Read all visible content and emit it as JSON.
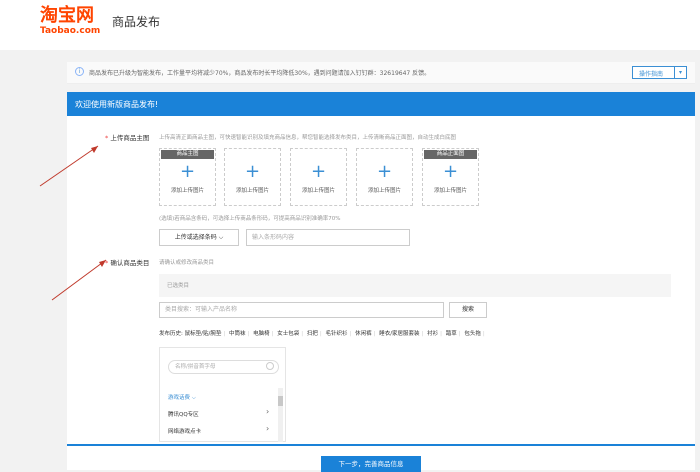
{
  "header": {
    "logo_cn": "淘宝网",
    "logo_en": "Taobao.com",
    "title": "商品发布"
  },
  "notice": {
    "icon": "info-icon",
    "text": "商品发布已升级为智能发布，工作量平均将减少70%，商品发布时长平均降低30%，遇到问题请加入钉钉群：32619647 反馈。",
    "guide_button": "操作指南"
  },
  "banner": {
    "text": "欢迎使用新版商品发布!"
  },
  "main_image": {
    "label": "上传商品主图",
    "hint": "上传高清正面商品主图，可快速智能识别及填充商品信息，帮您智能选择发布类目，上传清晰商品正面图，自动生成白底图",
    "boxes": [
      {
        "tag": "商品主图",
        "label": "添加上传图片"
      },
      {
        "tag": "",
        "label": "添加上传图片"
      },
      {
        "tag": "",
        "label": "添加上传图片"
      },
      {
        "tag": "",
        "label": "添加上传图片"
      },
      {
        "tag": "商品正面图",
        "label": "添加上传图片"
      }
    ],
    "barcode_hint": "(选填)若商品含条码，可选择上传商品条形码，可提高商品识别准确率70%",
    "barcode_button": "上传或选择条码",
    "barcode_placeholder": "输入条形码内容"
  },
  "category": {
    "label": "确认商品类目",
    "hint": "请确认或修改商品类目",
    "selected_label": "已选类目",
    "search_placeholder": "类目搜索：可输入产品名称",
    "search_button": "搜索",
    "history_label": "发布历史:",
    "history": [
      "鼠标垫/贴/腕垫",
      "中筒袜",
      "电脑椅",
      "女士包袋",
      "扫把",
      "毛针织衫",
      "休闲裤",
      "睡衣/家居服套装",
      "衬衫",
      "踏草",
      "包头拖"
    ],
    "panel": {
      "search_placeholder": "名称/拼音首字母",
      "group": "游戏话费",
      "items": [
        "腾讯QQ专区",
        "网络游戏点卡"
      ]
    }
  },
  "footer": {
    "next_button": "下一步，完善商品信息"
  }
}
